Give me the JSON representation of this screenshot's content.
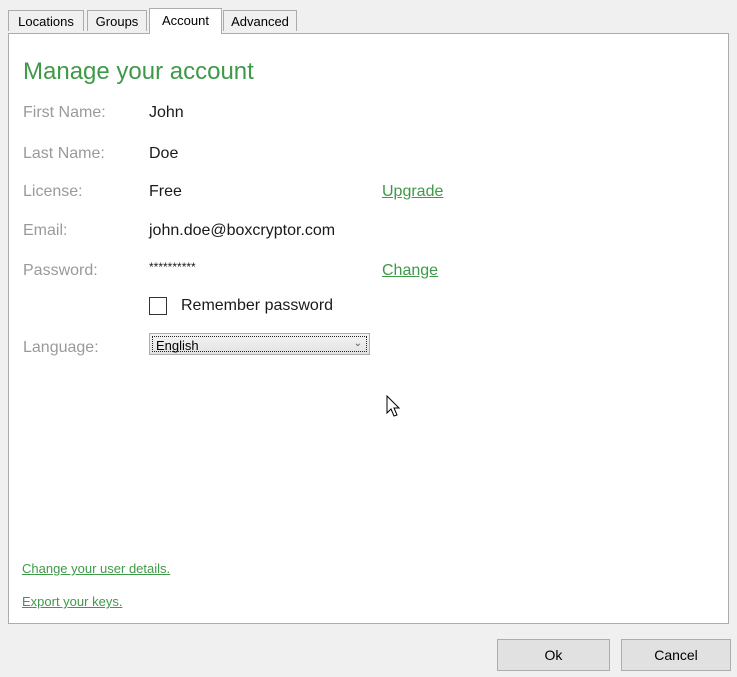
{
  "tabs": [
    {
      "label": "Locations",
      "active": false
    },
    {
      "label": "Groups",
      "active": false
    },
    {
      "label": "Account",
      "active": true
    },
    {
      "label": "Advanced",
      "active": false
    }
  ],
  "account": {
    "heading": "Manage your account",
    "first_name": {
      "label": "First Name:",
      "value": "John"
    },
    "last_name": {
      "label": "Last Name:",
      "value": "Doe"
    },
    "license": {
      "label": "License:",
      "value": "Free",
      "link": "Upgrade"
    },
    "email": {
      "label": "Email:",
      "value": "john.doe@boxcryptor.com"
    },
    "password": {
      "label": "Password:",
      "value": "**********",
      "link": "Change"
    },
    "remember_password": {
      "label": "Remember password",
      "checked": false
    },
    "language": {
      "label": "Language:",
      "selected": "English"
    }
  },
  "links": {
    "change_details": "Change your user details.",
    "export_keys": "Export your keys."
  },
  "buttons": {
    "ok": "Ok",
    "cancel": "Cancel"
  },
  "colors": {
    "accent": "#3e9a48",
    "label_gray": "#9a9a9a",
    "window_bg": "#f0f0f0",
    "border": "#acacac"
  }
}
